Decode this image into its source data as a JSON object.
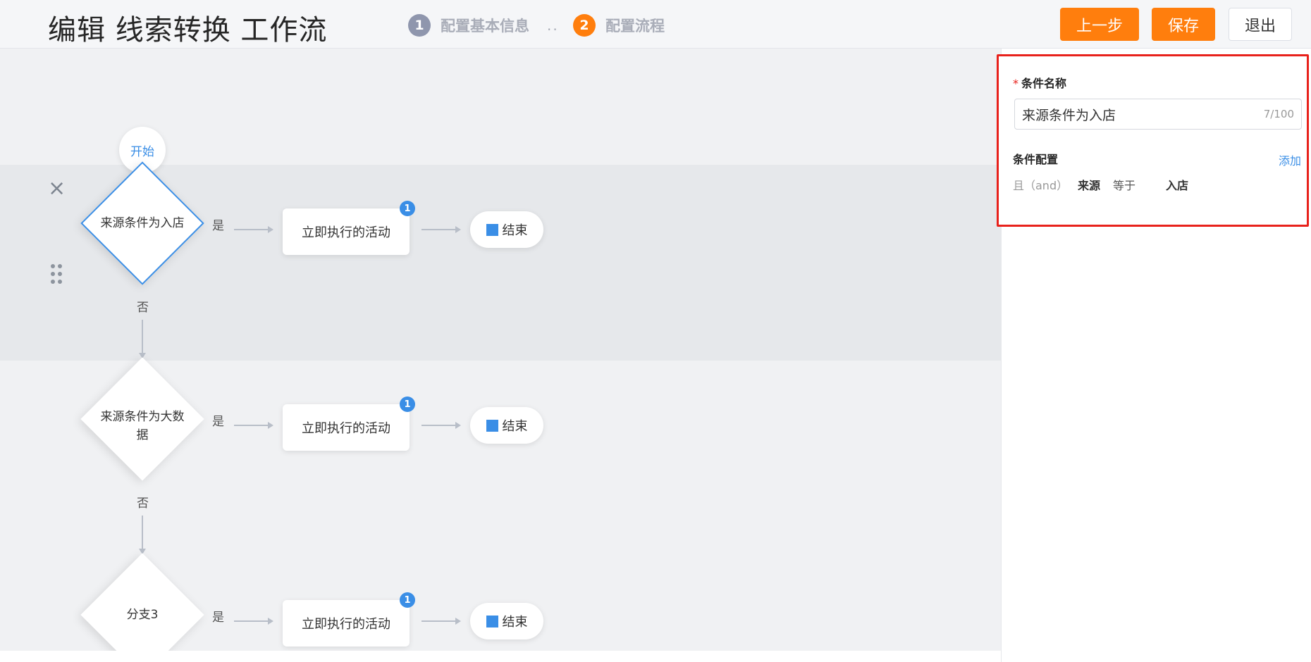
{
  "header": {
    "title": "编辑 线索转换 工作流",
    "steps": [
      {
        "num": "1",
        "label": "配置基本信息",
        "color": "#8f96ad"
      },
      {
        "num": "2",
        "label": "配置流程",
        "color": "#ff7e0d"
      }
    ],
    "step_separator": "..",
    "buttons": {
      "prev": "上一步",
      "save": "保存",
      "exit": "退出"
    }
  },
  "flow": {
    "start_label": "开始",
    "yes_label": "是",
    "no_label": "否",
    "branches": [
      {
        "condition": "来源条件为入店",
        "activity": "立即执行的活动",
        "badge": "1",
        "end": "结束"
      },
      {
        "condition": "来源条件为大数据",
        "activity": "立即执行的活动",
        "badge": "1",
        "end": "结束"
      },
      {
        "condition": "分支3",
        "activity": "立即执行的活动",
        "badge": "1",
        "end": "结束"
      }
    ]
  },
  "panel": {
    "name_label": "条件名称",
    "required_mark": "*",
    "name_value": "来源条件为入店",
    "name_counter": "7/100",
    "config_title": "条件配置",
    "add_label": "添加",
    "conditions": [
      {
        "logic": "且（and）",
        "field": "来源",
        "operator": "等于",
        "value": "入店"
      }
    ]
  },
  "colors": {
    "accent": "#ff7e0d",
    "link": "#3a8ee6",
    "highlight_border": "#e8211b"
  }
}
